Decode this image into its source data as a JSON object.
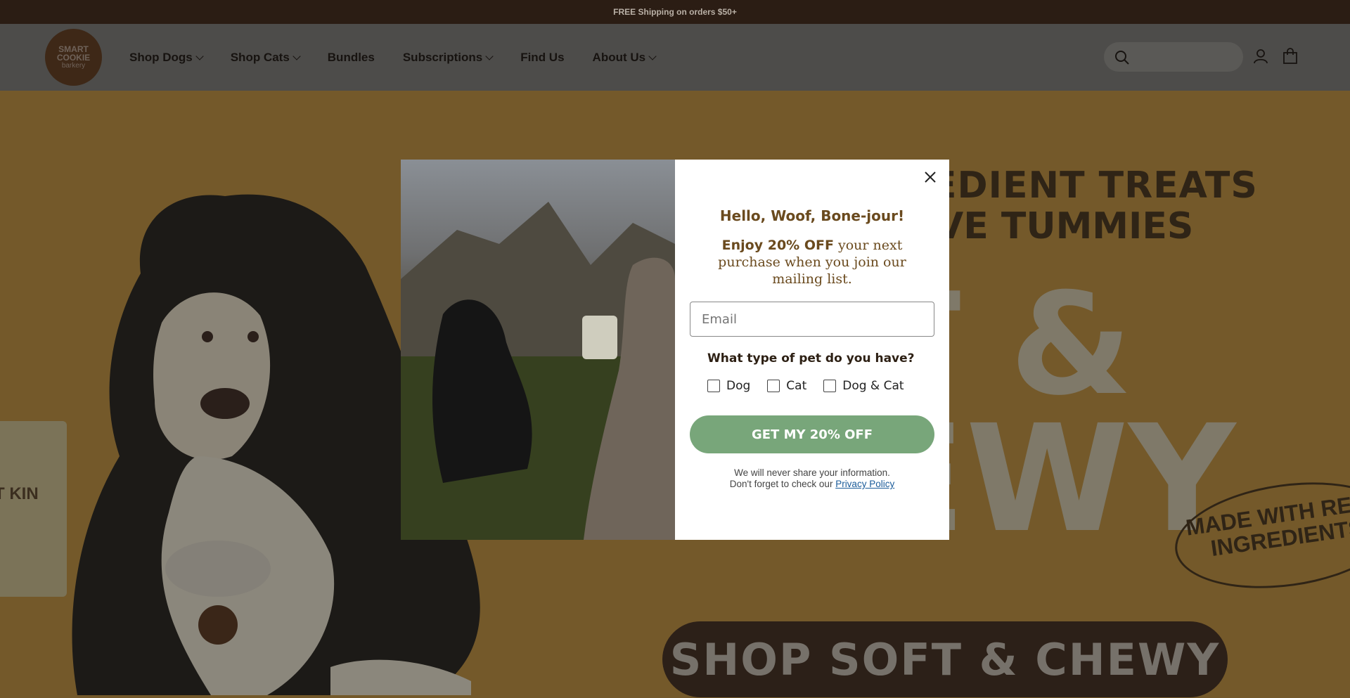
{
  "announcement": "FREE Shipping on orders $50+",
  "logo": {
    "line1": "SMART",
    "line2": "COOKIE",
    "line3": "barkery"
  },
  "nav": {
    "items": [
      {
        "label": "Shop Dogs",
        "dropdown": true
      },
      {
        "label": "Shop Cats",
        "dropdown": true
      },
      {
        "label": "Bundles",
        "dropdown": false
      },
      {
        "label": "Subscriptions",
        "dropdown": true
      },
      {
        "label": "Find Us",
        "dropdown": false
      },
      {
        "label": "About Us",
        "dropdown": true
      }
    ]
  },
  "hero": {
    "headline_line1": "EDIENT TREATS",
    "headline_line2": "VE TUMMIES",
    "big_word1": "T &",
    "big_word2": "EWY",
    "badge": "MADE WITH REAL INGREDIENTS",
    "shop_button": "SHOP  SOFT & CHEWY",
    "bag_text": "T KIN"
  },
  "modal": {
    "title": "Hello, Woof, Bone-jour!",
    "offer_strong": "Enjoy 20% OFF",
    "offer_rest": " your next purchase when you join our mailing list.",
    "email_placeholder": "Email",
    "pet_question": "What type of pet do you have?",
    "pet_options": [
      "Dog",
      "Cat",
      "Dog & Cat"
    ],
    "cta": "GET MY 20% OFF",
    "privacy_line1": "We will never share your information.",
    "privacy_line2": "Don't forget to check our ",
    "privacy_link": "Privacy Policy"
  },
  "colors": {
    "cta": "#78a67a",
    "title": "#6a4a1e",
    "announce_bg": "#2b1d14"
  }
}
